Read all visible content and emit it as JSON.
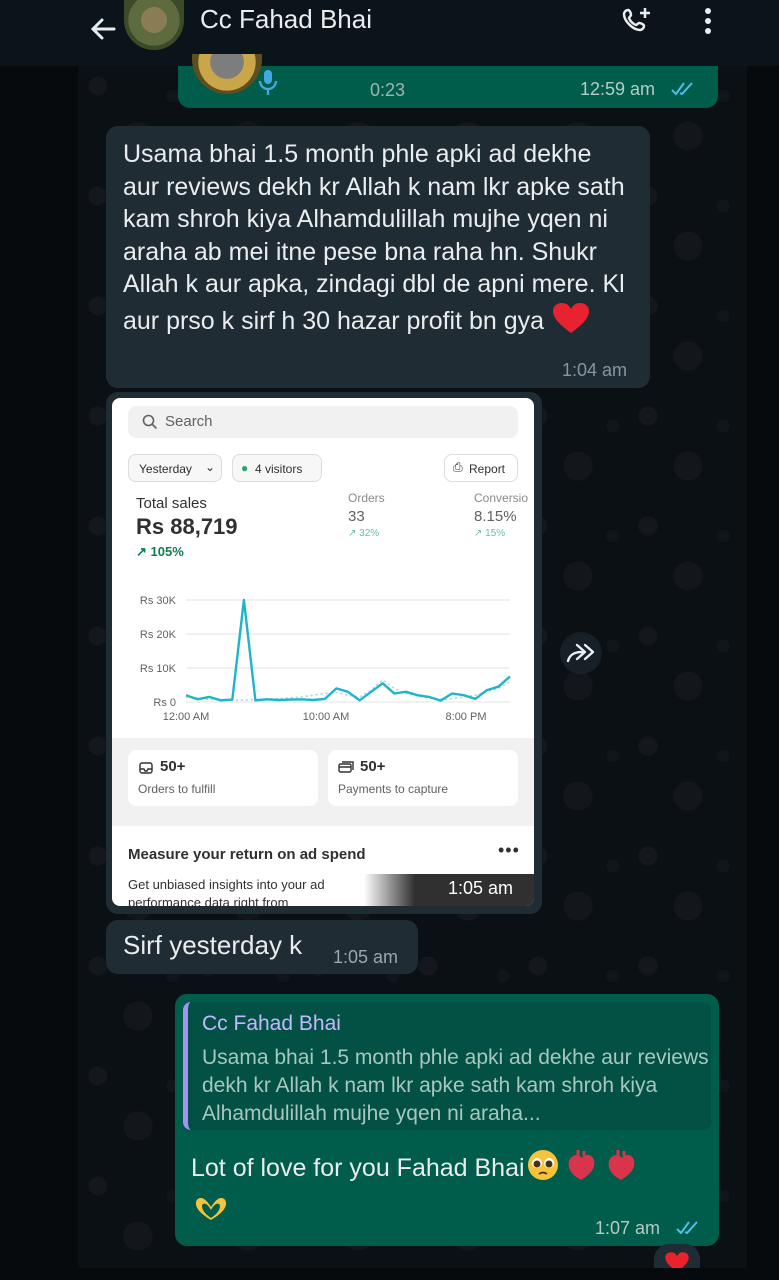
{
  "header": {
    "contact_name": "Cc Fahad Bhai"
  },
  "voice_message": {
    "duration": "0:23",
    "time": "12:59 am",
    "status": "read"
  },
  "messages": [
    {
      "direction": "incoming",
      "text": "Usama bhai 1.5 month phle apki ad dekhe aur reviews dekh kr Allah k nam lkr apke sath kam shroh kiya Alhamdulillah mujhe yqen ni araha ab mei itne pese bna raha hn. Shukr Allah k aur apka, zindagi dbl de apni mere. Kl aur prso k sirf h 30 hazar profit bn gya",
      "time": "1:04 am"
    },
    {
      "direction": "incoming",
      "type": "image",
      "time": "1:05 am"
    },
    {
      "direction": "incoming",
      "text": "Sirf yesterday k",
      "time": "1:05 am"
    },
    {
      "direction": "outgoing",
      "quote_name": "Cc Fahad Bhai",
      "quote_text": "Usama bhai 1.5 month phle apki ad dekhe aur reviews dekh kr Allah k nam lkr apke sath kam shroh kiya Alhamdulillah mujhe yqen ni araha...",
      "text": "Lot of love for you Fahad Bhai",
      "time": "1:07 am",
      "status": "read"
    }
  ],
  "screenshot": {
    "search_placeholder": "Search",
    "date_filter": "Yesterday",
    "visitors": "4 visitors",
    "report_label": "Report",
    "total_sales_label": "Total sales",
    "total_sales_value": "Rs 88,719",
    "total_sales_change": "105%",
    "orders_label": "Orders",
    "orders_value": "33",
    "orders_change": "32%",
    "conversion_label": "Conversio",
    "conversion_value": "8.15%",
    "conversion_change": "15%",
    "card1_value": "50+",
    "card1_label": "Orders to fulfill",
    "card2_value": "50+",
    "card2_label": "Payments to capture",
    "measure_title": "Measure your return on ad spend",
    "measure_text": "Get unbiased insights into your ad performance data right from"
  },
  "chart_data": {
    "type": "line",
    "y_ticks": [
      "Rs 30K",
      "Rs 20K",
      "Rs 10K",
      "Rs 0"
    ],
    "x_ticks": [
      "12:00 AM",
      "10:00 AM",
      "8:00 PM"
    ],
    "ylim": [
      0,
      30000
    ],
    "grid": true,
    "series": [
      {
        "color": "#1fb5c9",
        "style": "solid",
        "values": [
          2000,
          800,
          1500,
          500,
          700,
          30000,
          500,
          800,
          600,
          700,
          800,
          600,
          900,
          4000,
          3000,
          500,
          3000,
          5500,
          2500,
          3000,
          2000,
          1500,
          400,
          2500,
          2000,
          900,
          3500,
          4500,
          7500
        ]
      },
      {
        "color": "#9fd8e2",
        "style": "dotted",
        "values": [
          1500,
          1200,
          800,
          600,
          500,
          600,
          700,
          900,
          1000,
          1200,
          1500,
          2000,
          2500,
          2800,
          2000,
          1500,
          3500,
          6500,
          4000,
          2500,
          1800,
          1200,
          800,
          1000,
          1500,
          2000,
          3000,
          4000,
          6000
        ]
      }
    ]
  },
  "colors": {
    "outgoing_bubble": "#005c4b",
    "incoming_bubble": "#202c33",
    "read_ticks": "#53bdeb",
    "chart_line": "#1fb5c9",
    "positive_change": "#0c7d4f"
  }
}
